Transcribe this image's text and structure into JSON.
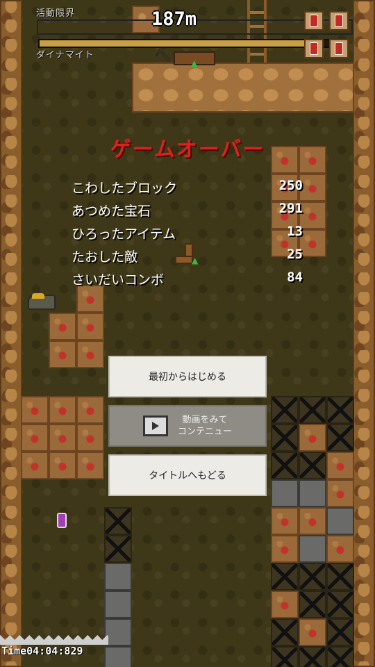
{
  "hud": {
    "activity_limit_label": "活動限界",
    "depth_value": "187m",
    "dynamite_label": "ダイナマイト",
    "limit_fill_fraction": 0.92
  },
  "game_over": {
    "title": "ゲームオーバー",
    "stats": [
      {
        "label": "こわしたブロック",
        "value": "250"
      },
      {
        "label": "あつめた宝石",
        "value": "291"
      },
      {
        "label": "ひろったアイテム",
        "value": "13"
      },
      {
        "label": "たおした敵",
        "value": "25"
      },
      {
        "label": "さいだいコンボ",
        "value": "84"
      }
    ]
  },
  "menu": {
    "restart_label": "最初からはじめる",
    "continue_label": "動画をみて\nコンテニュー",
    "title_label": "タイトルへもどる"
  },
  "timer": {
    "text": "Time04:04:829"
  },
  "icons": {
    "dynamite": "dynamite-icon",
    "video": "video-icon",
    "player": "player-icon",
    "potion": "potion-icon",
    "boot": "boot-icon"
  }
}
